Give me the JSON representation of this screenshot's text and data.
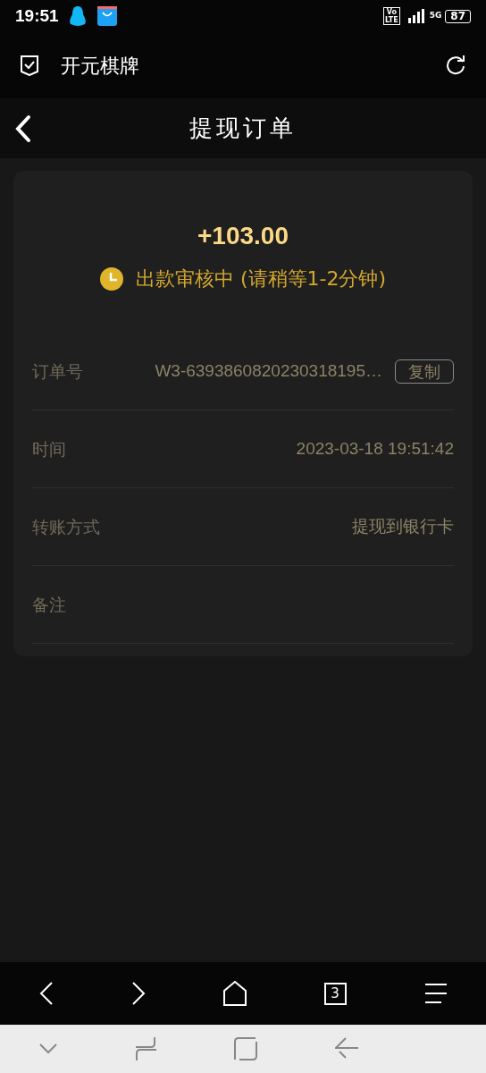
{
  "status_bar": {
    "time": "19:51",
    "battery": "87",
    "network": "5G",
    "volte": [
      "Vo",
      "LTE"
    ]
  },
  "browser": {
    "title": "开元棋牌",
    "tab_count": "3"
  },
  "header": {
    "title": "提现订单"
  },
  "order": {
    "amount": "+103.00",
    "status": "出款审核中 (请稍等1-2分钟)",
    "rows": [
      {
        "kind": "copy",
        "label": "订单号",
        "value": "W3-6393860820230318195…",
        "action": "复制"
      },
      {
        "kind": "text",
        "label": "时间",
        "value": "2023-03-18 19:51:42"
      },
      {
        "kind": "text",
        "label": "转账方式",
        "value": "提现到银行卡"
      },
      {
        "kind": "text",
        "label": "备注"
      }
    ]
  }
}
